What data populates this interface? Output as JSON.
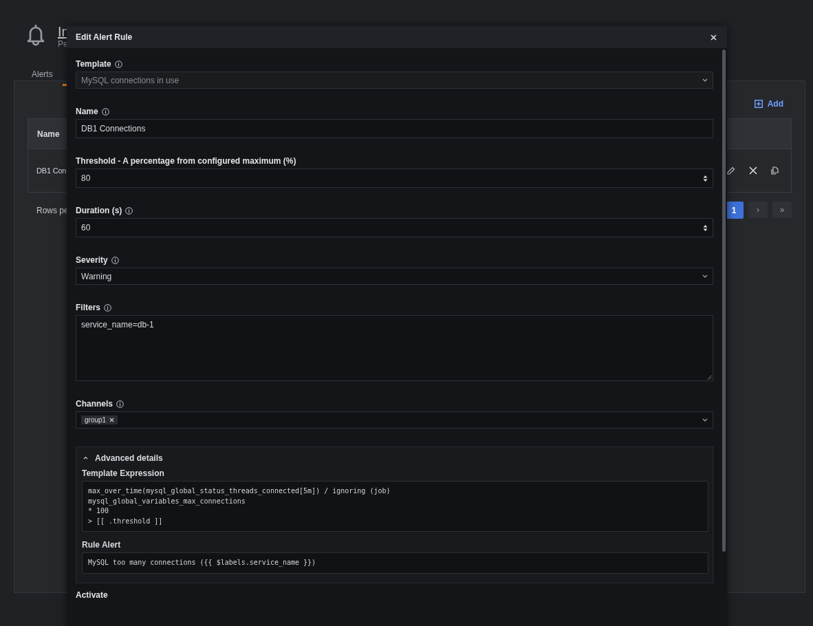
{
  "page": {
    "title": "In",
    "subtitle": "Pe",
    "tabs": [
      {
        "label": "Alerts",
        "selected": false
      },
      {
        "selected": true
      }
    ],
    "add_button": "Add",
    "table": {
      "columns": [
        "Name"
      ],
      "rows": [
        {
          "cells": [
            "DB1 Con"
          ]
        }
      ]
    },
    "rows_per_page_label": "Rows pe",
    "pagination": {
      "pages": [
        {
          "label": "1",
          "selected": true
        }
      ],
      "next": "›",
      "last": "»"
    }
  },
  "modal": {
    "title": "Edit Alert Rule",
    "fields": [
      {
        "kind": "select",
        "label": "Template",
        "info": true,
        "value": "MySQL connections in use",
        "disabled": true
      },
      {
        "kind": "text",
        "label": "Name",
        "info": true,
        "value": "DB1 Connections"
      },
      {
        "kind": "number",
        "label": "Threshold - A percentage from configured maximum (%)",
        "info": false,
        "value": "80"
      },
      {
        "kind": "number",
        "label": "Duration (s)",
        "info": true,
        "value": "60"
      },
      {
        "kind": "select",
        "label": "Severity",
        "info": true,
        "value": "Warning",
        "disabled": false
      },
      {
        "kind": "textarea",
        "label": "Filters",
        "info": true,
        "value": "service_name=db-1"
      },
      {
        "kind": "multiselect",
        "label": "Channels",
        "info": true,
        "tags": [
          "group1"
        ]
      }
    ],
    "advanced": {
      "title": "Advanced details",
      "expanded": true,
      "template_expression_label": "Template Expression",
      "template_expression": "max_over_time(mysql_global_status_threads_connected[5m]) / ignoring (job)\nmysql_global_variables_max_connections\n* 100\n> [[ .threshold ]]",
      "rule_alert_label": "Rule Alert",
      "rule_alert": "MySQL too many connections ({{ $labels.service_name }})"
    },
    "activate_label": "Activate"
  }
}
